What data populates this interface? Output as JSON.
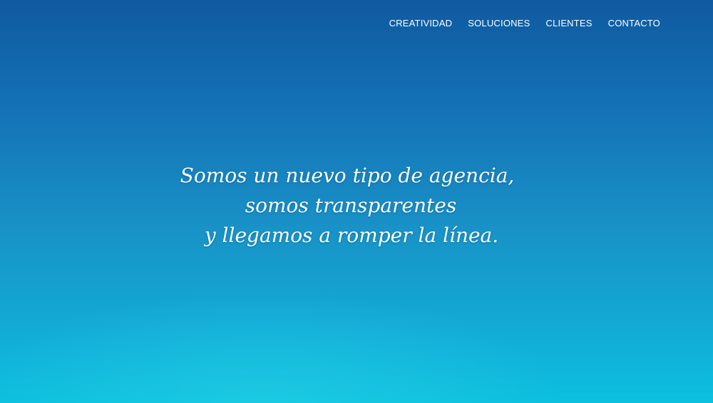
{
  "nav": {
    "items": [
      {
        "label": "CREATIVIDAD"
      },
      {
        "label": "SOLUCIONES"
      },
      {
        "label": "CLIENTES"
      },
      {
        "label": "CONTACTO"
      }
    ]
  },
  "hero": {
    "tagline_lines": [
      "Somos un nuevo tipo de agencia,",
      "somos transparentes",
      "y llegamos a romper la línea."
    ]
  },
  "colors": {
    "background_top": "#0f5aa0",
    "background_bottom": "#0cc0de",
    "text": "#ffffff"
  }
}
